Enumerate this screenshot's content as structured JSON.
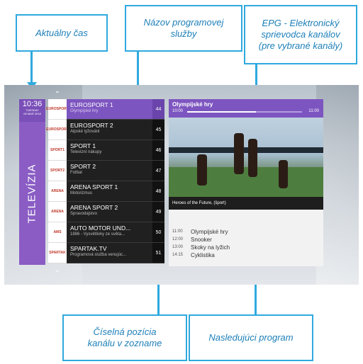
{
  "callouts": {
    "time": "Aktuálny čas",
    "service": "Názov programovej\nslužby",
    "epg": "EPG - Elektronický\nsprievodca kanálov\n(pre vybrané kanály)",
    "position": "Číselná pozícia\nkanálu v zozname",
    "next": "Nasledujúci program"
  },
  "clock": {
    "time": "10:36",
    "day": "TUESDAY",
    "date": "06 MAR 2018"
  },
  "section_label": "TELEVÍZIA",
  "channels": [
    {
      "logo": "EUROSPORT",
      "name": "EUROSPORT 1",
      "program": "Olympijské hry",
      "number": "44",
      "selected": true
    },
    {
      "logo": "EUROSPORT",
      "name": "EUROSPORT 2",
      "program": "Alpské lyžovánl",
      "number": "45"
    },
    {
      "logo": "SPORT1",
      "name": "SPORT 1",
      "program": "Televizní nákupy",
      "number": "46"
    },
    {
      "logo": "SPORT2",
      "name": "SPORT 2",
      "program": "Fotbal",
      "number": "47"
    },
    {
      "logo": "ARENA",
      "name": "ARENA SPORT 1",
      "program": "Motorizmus",
      "number": "48"
    },
    {
      "logo": "ARENA",
      "name": "ARENA SPORT 2",
      "program": "Spravodajstvo",
      "number": "49"
    },
    {
      "logo": "AMS",
      "name": "AUTO MOTOR UND...",
      "program": "1886 - Vysvětlivky ze světa...",
      "number": "50"
    },
    {
      "logo": "SPARTAK",
      "name": "SPARTAK.TV",
      "program": "Programová služba venujúc...",
      "number": "51"
    }
  ],
  "epg": {
    "title": "Olympijské hry",
    "start": "10:00",
    "end": "11:00",
    "progress": 0.6,
    "caption": "Heroes of the Future, (šport)",
    "schedule": [
      {
        "time": "11:00",
        "title": "Olympijské hry"
      },
      {
        "time": "12:00",
        "title": "Snooker"
      },
      {
        "time": "13:00",
        "title": "Skoky na lyžich"
      },
      {
        "time": "14:15",
        "title": "Cyklistika"
      }
    ]
  },
  "colors": {
    "accent": "#7d55c0",
    "callout": "#2fa9de"
  }
}
